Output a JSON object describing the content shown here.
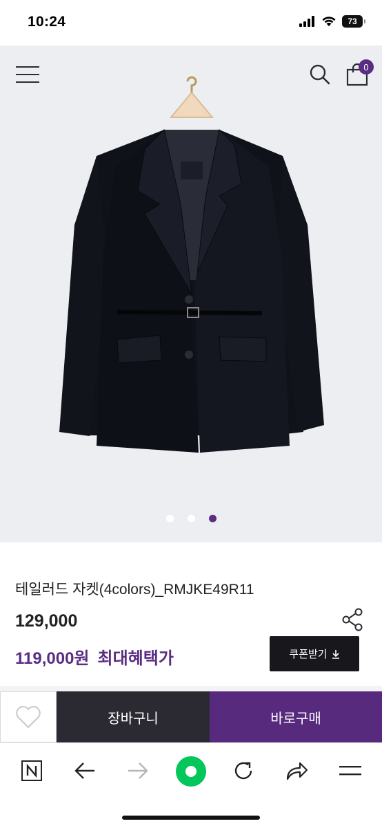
{
  "status_bar": {
    "time": "10:24",
    "battery": "73"
  },
  "header": {
    "cart_count": "0"
  },
  "hero": {
    "slides": 3,
    "active_slide": 3
  },
  "product": {
    "name": "테일러드 자켓(4colors)_RMJKE49R11",
    "price": "129,000",
    "sale_price": "119,000원",
    "sale_label": "최대혜택가",
    "coupon_label": "쿠폰받기"
  },
  "actions": {
    "cart_label": "장바구니",
    "buy_label": "바로구매"
  },
  "colors": {
    "accent": "#5a2d82",
    "dark": "#2b2a33",
    "naver_green": "#03c75a"
  },
  "icons": [
    "menu-icon",
    "search-icon",
    "shopping-bag-icon",
    "share-icon",
    "download-icon",
    "heart-icon",
    "naver-icon",
    "back-arrow-icon",
    "forward-arrow-icon",
    "green-dot-icon",
    "refresh-icon",
    "share-arrow-icon",
    "more-menu-icon"
  ]
}
